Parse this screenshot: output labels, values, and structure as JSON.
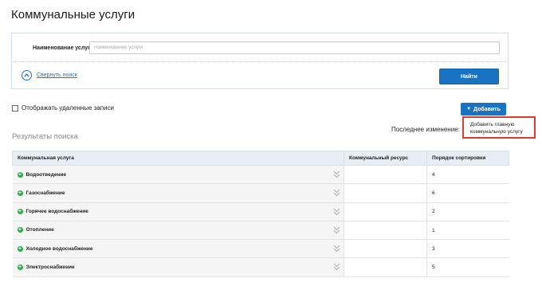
{
  "page": {
    "title": "Коммунальные услуги"
  },
  "search": {
    "label": "Наименование услуги",
    "placeholder": "Наименование услуги",
    "value": "",
    "collapse_label": "Свернуть поиск",
    "find_label": "Найти"
  },
  "toolbar": {
    "show_deleted_label": "Отображать удаленные записи",
    "show_deleted_checked": false,
    "add_label": "Добавить",
    "add_menu": {
      "item_main_service": "Добавить главную коммунальную услугу"
    }
  },
  "results": {
    "title": "Результаты поиска",
    "last_change_label": "Последнее изменение:",
    "columns": [
      "Коммунальная услуга",
      "Коммунальный ресурс",
      "Порядок сортировки"
    ],
    "rows": [
      {
        "service": "Водоотведение",
        "resource": "",
        "order": "4"
      },
      {
        "service": "Газоснабжение",
        "resource": "",
        "order": "6"
      },
      {
        "service": "Горячее водоснабжение",
        "resource": "",
        "order": "2"
      },
      {
        "service": "Отопление",
        "resource": "",
        "order": "1"
      },
      {
        "service": "Холодное водоснабжение",
        "resource": "",
        "order": "3"
      },
      {
        "service": "Электроснабжение",
        "resource": "",
        "order": "5"
      }
    ]
  },
  "colors": {
    "accent": "#1a73c2",
    "expand_icon": "#2aa84a",
    "highlight_border": "#e03a2f"
  },
  "icons": {
    "collapse": "chevron-up-circle-icon",
    "expand": "plus-circle-icon",
    "row_toggle": "double-chevron-down-icon",
    "add_caret": "caret-down-icon"
  }
}
